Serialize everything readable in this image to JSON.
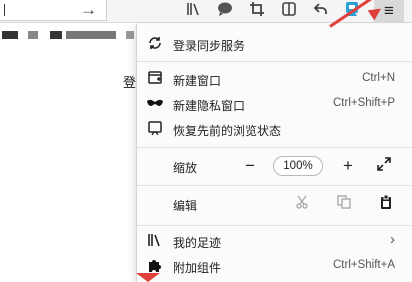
{
  "toolbar": {
    "go_icon": "right-arrow",
    "icons": [
      "library-icon",
      "chat-icon",
      "crop-icon",
      "reader-icon",
      "back-undo-icon",
      "extension-icon"
    ],
    "menu_icon": "hamburger-menu-icon",
    "menu_highlight": "#d9d9db"
  },
  "page": {
    "side_text": "登"
  },
  "menu": {
    "sync": {
      "label": "登录同步服务",
      "icon": "sync-icon"
    },
    "new_window": {
      "label": "新建窗口",
      "shortcut": "Ctrl+N",
      "icon": "new-window-icon"
    },
    "private_window": {
      "label": "新建隐私窗口",
      "shortcut": "Ctrl+Shift+P",
      "icon": "mask-icon"
    },
    "restore_session": {
      "label": "恢复先前的浏览状态",
      "icon": "restore-icon"
    },
    "zoom": {
      "label": "缩放",
      "value": "100%",
      "minus": "−",
      "plus": "+",
      "fullscreen_icon": "expand-arrows-icon"
    },
    "edit": {
      "label": "编辑",
      "icons": [
        "cut-icon",
        "copy-icon",
        "paste-icon"
      ]
    },
    "library": {
      "label": "我的足迹",
      "icon": "library-icon",
      "arrow": "›"
    },
    "addons": {
      "label": "附加组件",
      "shortcut": "Ctrl+Shift+A",
      "icon": "puzzle-icon"
    }
  },
  "colors": {
    "annotation": "#e0403a",
    "panel_bg": "#fbfbfb"
  }
}
